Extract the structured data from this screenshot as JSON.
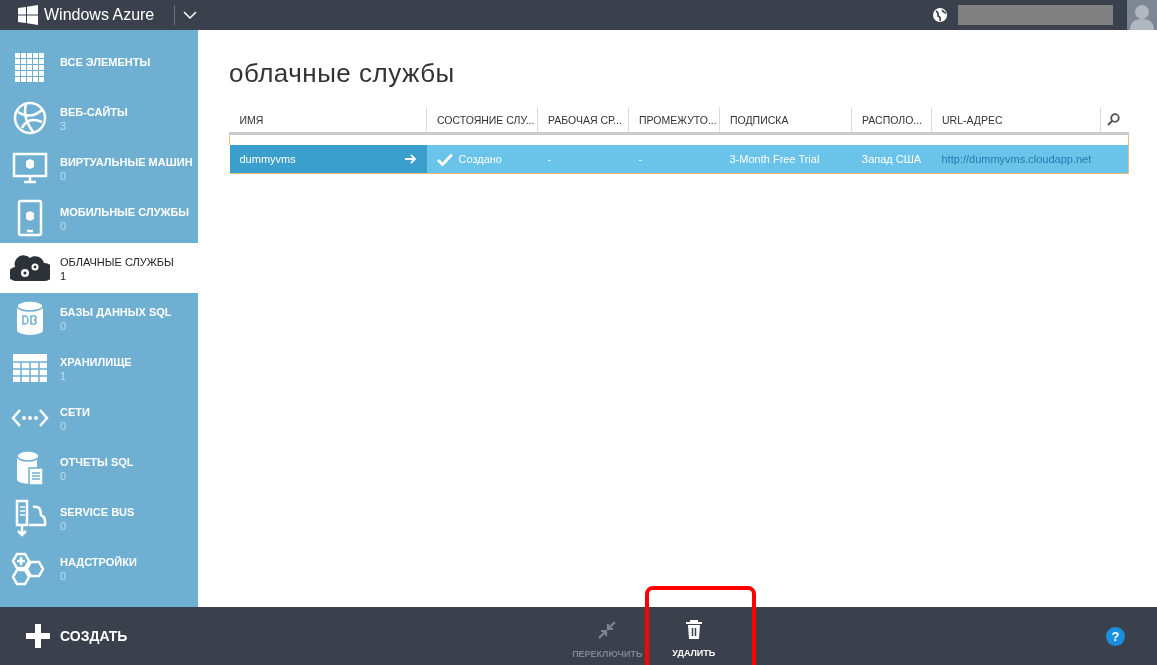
{
  "top_bar": {
    "brand": "Windows Azure"
  },
  "sidebar": {
    "items": [
      {
        "label": "ВСЕ ЭЛЕМЕНТЫ",
        "selected": false
      },
      {
        "label": "ВЕБ-САЙТЫ",
        "count": "3",
        "selected": false
      },
      {
        "label": "ВИРТУАЛЬНЫЕ МАШИН",
        "count": "0",
        "selected": false
      },
      {
        "label": "МОБИЛЬНЫЕ СЛУЖБЫ",
        "count": "0",
        "selected": false
      },
      {
        "label": "ОБЛАЧНЫЕ СЛУЖБЫ",
        "count": "1",
        "selected": true
      },
      {
        "label": "БАЗЫ ДАННЫХ SQL",
        "count": "0",
        "selected": false
      },
      {
        "label": "ХРАНИЛИЩЕ",
        "count": "1",
        "selected": false
      },
      {
        "label": "СЕТИ",
        "count": "0",
        "selected": false
      },
      {
        "label": "ОТЧЕТЫ SQL",
        "count": "0",
        "selected": false
      },
      {
        "label": "SERVICE BUS",
        "count": "0",
        "selected": false
      },
      {
        "label": "НАДСТРОЙКИ",
        "count": "0",
        "selected": false
      }
    ]
  },
  "page_title": "облачные службы",
  "table": {
    "columns": [
      "ИМЯ",
      "СОСТОЯНИЕ СЛУ...",
      "РАБОЧАЯ СР...",
      "ПРОМЕЖУТО...",
      "ПОДПИСКА",
      "РАСПОЛО...",
      "URL-АДРЕС"
    ],
    "rows": [
      {
        "selected": true,
        "name": "dummyvms",
        "status": "Создано",
        "column_3": "-",
        "column_4": "-",
        "subscription": "3-Month Free Trial",
        "location": "Запад США",
        "url": "http://dummyvms.cloudapp.net"
      }
    ]
  },
  "command_bar": {
    "new_label": "СОЗДАТЬ",
    "commands": [
      {
        "label": "ПЕРЕКЛЮЧИТЬ",
        "disabled": true,
        "highlighted": false
      },
      {
        "label": "УДАЛИТЬ",
        "disabled": false,
        "highlighted": true
      }
    ],
    "help": "?"
  }
}
